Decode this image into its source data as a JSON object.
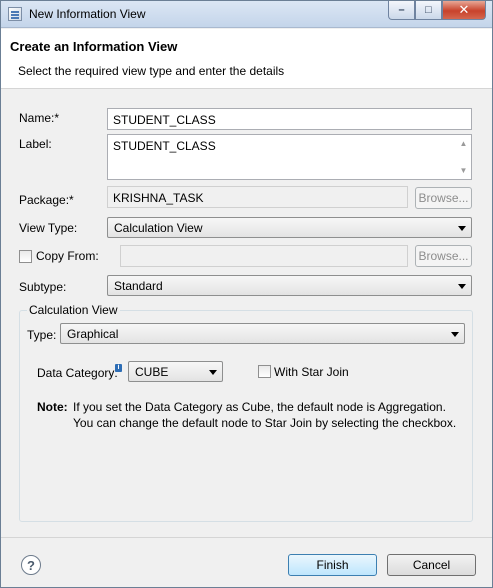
{
  "window": {
    "title": "New Information View",
    "controls": {
      "minimize": "–",
      "maximize": "□",
      "close": "✕"
    }
  },
  "header": {
    "title": "Create an Information View",
    "description": "Select the required view type and enter the details"
  },
  "form": {
    "name": {
      "label": "Name:*",
      "value": "STUDENT_CLASS"
    },
    "label_field": {
      "label": "Label:",
      "value": "STUDENT_CLASS"
    },
    "package": {
      "label": "Package:*",
      "value": "KRISHNA_TASK",
      "browse": "Browse..."
    },
    "view_type": {
      "label": "View Type:",
      "value": "Calculation View"
    },
    "copy_from": {
      "label": "Copy From:",
      "checked": false,
      "value": "",
      "browse": "Browse..."
    },
    "subtype": {
      "label": "Subtype:",
      "value": "Standard"
    }
  },
  "calc_view": {
    "group_title": "Calculation View",
    "type": {
      "label": "Type:",
      "value": "Graphical"
    },
    "data_category": {
      "label": "Data Category:",
      "value": "CUBE"
    },
    "star_join": {
      "label": "With Star Join",
      "checked": false
    },
    "note": {
      "label": "Note:",
      "line1": "If you set the Data Category as Cube, the default node is Aggregation.",
      "line2": "You can change the default node to Star Join by selecting the checkbox."
    }
  },
  "footer": {
    "help": "?",
    "finish": "Finish",
    "cancel": "Cancel"
  }
}
